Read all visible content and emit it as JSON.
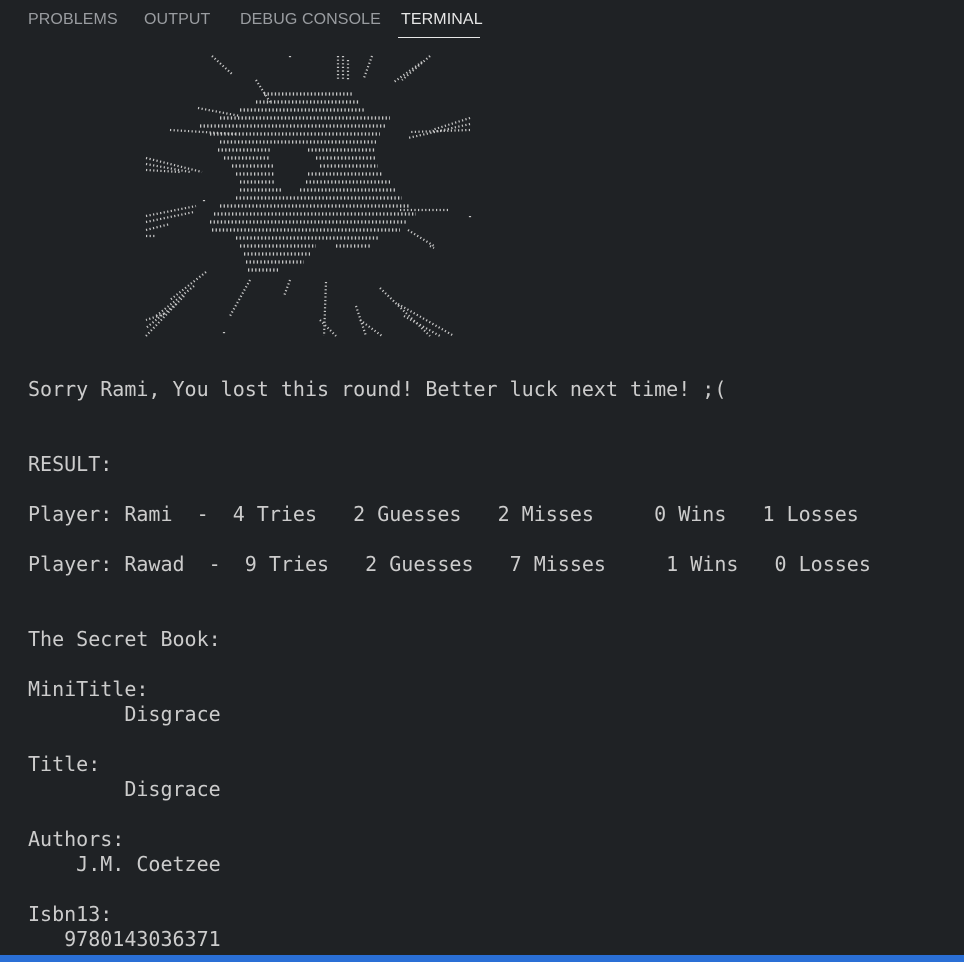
{
  "tabs": [
    {
      "label": "PROBLEMS",
      "active": false
    },
    {
      "label": "OUTPUT",
      "active": false
    },
    {
      "label": "DEBUG CONSOLE",
      "active": false
    },
    {
      "label": "TERMINAL",
      "active": true
    }
  ],
  "terminal": {
    "message": "Sorry Rami, You lost this round! Better luck next time! ;(",
    "result_heading": "RESULT:",
    "players": [
      "Player: Rami  -  4 Tries   2 Guesses   2 Misses     0 Wins   1 Losses",
      "Player: Rawad  -  9 Tries   2 Guesses   7 Misses     1 Wins   0 Losses"
    ],
    "book_heading": "The Secret Book:",
    "minititle_label": "MiniTitle:",
    "minititle_value": "        Disgrace",
    "title_label": "Title:",
    "title_value": "        Disgrace",
    "authors_label": "Authors:",
    "authors_value": "    J.M. Coetzee",
    "isbn_label": "Isbn13:",
    "isbn_value": "   9780143036371"
  },
  "colors": {
    "background": "#1f2225",
    "text": "#cccccc",
    "tab_inactive": "#9a9da1",
    "tab_active": "#e7e7e7",
    "status_bar": "#2a6fd6"
  }
}
